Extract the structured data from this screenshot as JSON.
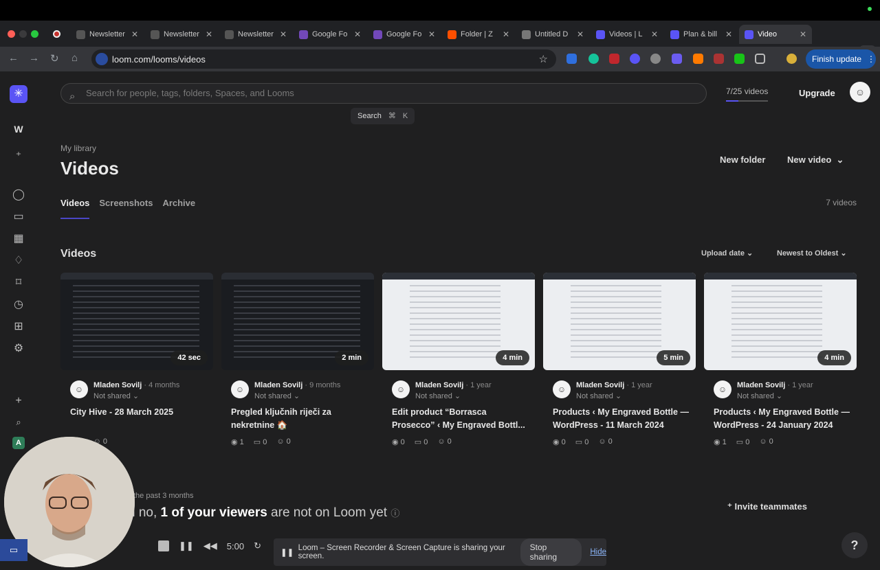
{
  "browser": {
    "tabs": [
      {
        "label": "Newsletter",
        "favicon": "notion-icon",
        "color": "#555"
      },
      {
        "label": "Newsletter",
        "favicon": "notion-icon",
        "color": "#555"
      },
      {
        "label": "Newsletter",
        "favicon": "notion-icon",
        "color": "#555"
      },
      {
        "label": "Google Fo",
        "favicon": "forms-icon",
        "color": "#7248b9"
      },
      {
        "label": "Google Fo",
        "favicon": "forms-icon",
        "color": "#7248b9"
      },
      {
        "label": "Folder | Z",
        "favicon": "zapier-icon",
        "color": "#ff4f00"
      },
      {
        "label": "Untitled D",
        "favicon": "diagram-icon",
        "color": "#777"
      },
      {
        "label": "Videos | L",
        "favicon": "loom-icon",
        "color": "#5a54f5"
      },
      {
        "label": "Plan & bill",
        "favicon": "loom-icon",
        "color": "#5a54f5"
      },
      {
        "label": "Video",
        "favicon": "loom-icon",
        "color": "#5a54f5"
      }
    ],
    "url": "loom.com/looms/videos",
    "finish_update": "Finish update"
  },
  "header": {
    "search_placeholder": "Search for people, tags, folders, Spaces, and Looms",
    "search_hint": "Search",
    "search_key1": "⌘",
    "search_key2": "K",
    "quota": "7/25 videos",
    "upgrade": "Upgrade"
  },
  "rail": {
    "workspace_initial": "W",
    "bottom_initial": "A"
  },
  "page": {
    "breadcrumb": "My library",
    "title": "Videos",
    "new_folder": "New folder",
    "new_video": "New video",
    "tabs": [
      "Videos",
      "Screenshots",
      "Archive"
    ],
    "count": "7 videos",
    "section_title": "Videos",
    "sort_by": "Upload date",
    "sort_order": "Newest to Oldest"
  },
  "videos": [
    {
      "duration": "42 sec",
      "owner": "Mladen Sovilj",
      "age": "4 months",
      "share": "Not shared",
      "title": "City Hive - 28 March 2025",
      "views": "",
      "comments": "0",
      "reactions": "0",
      "theme": "dark"
    },
    {
      "duration": "2 min",
      "owner": "Mladen Sovilj",
      "age": "9 months",
      "share": "Not shared",
      "title": "Pregled ključnih riječi za nekretnine 🏠",
      "views": "1",
      "comments": "0",
      "reactions": "0",
      "theme": "dark"
    },
    {
      "duration": "4 min",
      "owner": "Mladen Sovilj",
      "age": "1 year",
      "share": "Not shared",
      "title": "Edit product “Borrasca Prosecco” ‹ My Engraved Bottl...",
      "views": "0",
      "comments": "0",
      "reactions": "0",
      "theme": "light"
    },
    {
      "duration": "5 min",
      "owner": "Mladen Sovilj",
      "age": "1 year",
      "share": "Not shared",
      "title": "Products ‹ My Engraved Bottle — WordPress - 11 March 2024",
      "views": "0",
      "comments": "0",
      "reactions": "0",
      "theme": "light"
    },
    {
      "duration": "4 min",
      "owner": "Mladen Sovilj",
      "age": "1 year",
      "share": "Not shared",
      "title": "Products ‹ My Engraved Bottle — WordPress - 24 January 2024",
      "views": "1",
      "comments": "0",
      "reactions": "0",
      "theme": "light"
    }
  ],
  "banner": {
    "sub": "the past 3 months",
    "main_prefix": "h no, ",
    "main_bold": "1 of your viewers",
    "main_suffix": " are not on Loom yet",
    "invite": "Invite teammates"
  },
  "recorder": {
    "time": "5:00",
    "share_message": "Loom – Screen Recorder & Screen Capture is sharing your screen.",
    "stop_sharing": "Stop sharing",
    "hide": "Hide"
  },
  "help": "?"
}
